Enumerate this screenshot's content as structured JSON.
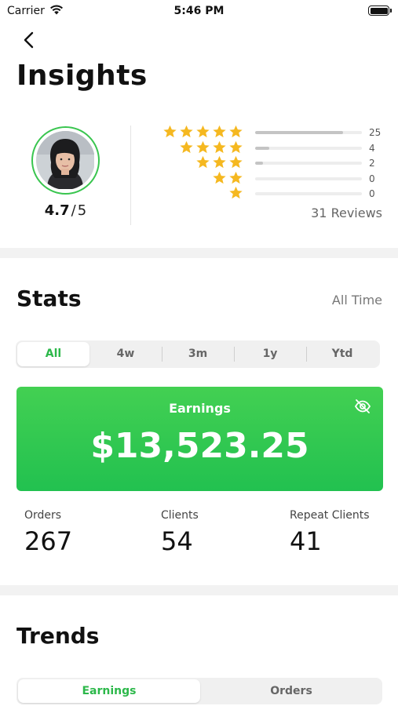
{
  "status_bar": {
    "carrier": "Carrier",
    "time": "5:46 PM"
  },
  "header": {
    "title": "Insights",
    "back_icon": "chevron-left-icon"
  },
  "rating": {
    "value": "4.7",
    "separator": "/",
    "max": "5",
    "reviews_label": "31 Reviews",
    "star_color": "#f5b820",
    "breakdown": [
      {
        "stars": 5,
        "count": "25",
        "fraction": 0.82
      },
      {
        "stars": 4,
        "count": "4",
        "fraction": 0.13
      },
      {
        "stars": 3,
        "count": "2",
        "fraction": 0.07
      },
      {
        "stars": 2,
        "count": "0",
        "fraction": 0
      },
      {
        "stars": 1,
        "count": "0",
        "fraction": 0
      }
    ]
  },
  "stats": {
    "title": "Stats",
    "range_label": "All Time",
    "tabs": [
      "All",
      "4w",
      "3m",
      "1y",
      "Ytd"
    ],
    "active_tab": 0,
    "earnings": {
      "label": "Earnings",
      "value": "$13,523.25",
      "toggle_icon": "eye-off-icon"
    },
    "metrics": [
      {
        "label": "Orders",
        "value": "267"
      },
      {
        "label": "Clients",
        "value": "54"
      },
      {
        "label": "Repeat Clients",
        "value": "41"
      }
    ]
  },
  "trends": {
    "title": "Trends",
    "tabs": [
      "Earnings",
      "Orders"
    ],
    "active_tab": 0
  },
  "colors": {
    "accent": "#2cb84a",
    "card_gradient_top": "#43d052",
    "card_gradient_bottom": "#22c150"
  }
}
